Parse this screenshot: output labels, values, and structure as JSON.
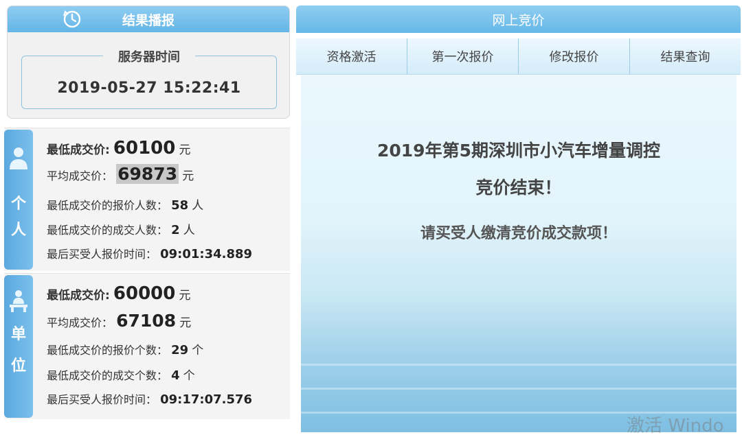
{
  "result_panel": {
    "title": "结果播报",
    "server_time_label": "服务器时间",
    "server_time": "2019-05-27 15:22:41"
  },
  "personal": {
    "tab_char1": "个",
    "tab_char2": "人",
    "lowest_price_label": "最低成交价:",
    "lowest_price": "60100",
    "avg_price_label": "平均成交价：",
    "avg_price": "69873",
    "yuan": "元",
    "bidders_at_lowest_label": "最低成交价的报价人数：",
    "bidders_at_lowest": "58",
    "deals_at_lowest_label": "最低成交价的成交人数：",
    "deals_at_lowest": "2",
    "person_unit": "人",
    "last_bid_time_label": "最后买受人报价时间：",
    "last_bid_time": "09:01:34.889"
  },
  "unit": {
    "tab_char1": "单",
    "tab_char2": "位",
    "lowest_price_label": "最低成交价:",
    "lowest_price": "60000",
    "avg_price_label": "平均成交价：",
    "avg_price": "67108",
    "yuan": "元",
    "bids_at_lowest_label": "最低成交价的报价个数：",
    "bids_at_lowest": "29",
    "deals_at_lowest_label": "最低成交价的成交个数：",
    "deals_at_lowest": "4",
    "count_unit": "个",
    "last_bid_time_label": "最后买受人报价时间：",
    "last_bid_time": "09:17:07.576"
  },
  "bidding": {
    "title": "网上竞价",
    "tabs": [
      "资格激活",
      "第一次报价",
      "修改报价",
      "结果查询"
    ],
    "message_line1": "2019年第5期深圳市小汽车增量调控",
    "message_line2": "竞价结束！",
    "message_line3": "请买受人缴清竞价成交款项！"
  },
  "watermark": "激活 Windo",
  "colors": {
    "header_blue": "#63b5e6",
    "tab_blue": "#5aa8df"
  }
}
